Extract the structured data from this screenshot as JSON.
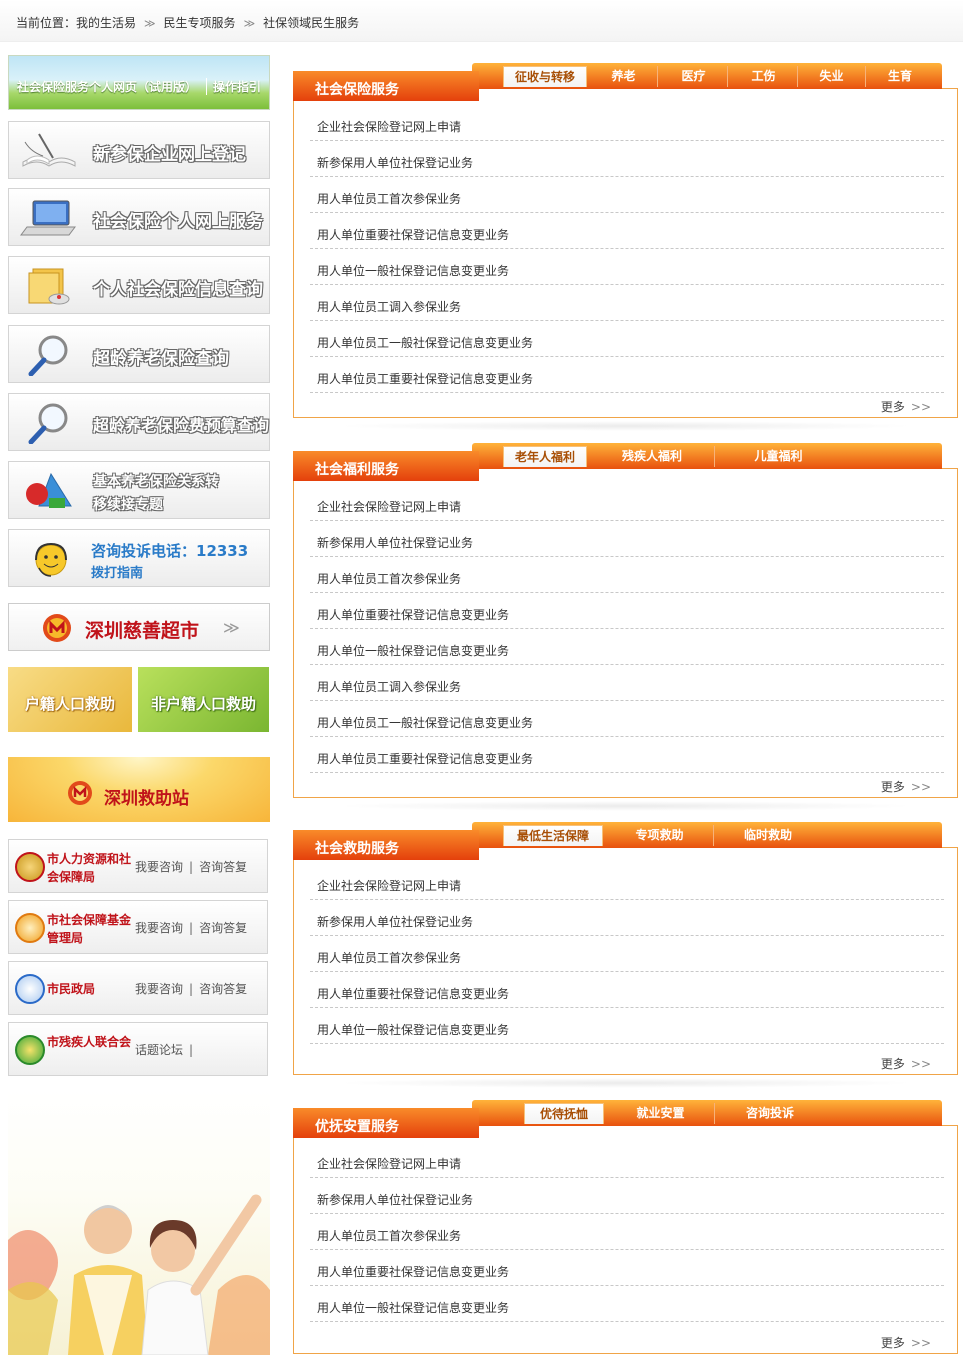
{
  "breadcrumb": {
    "prefix": "当前位置：",
    "items": [
      "我的生活易",
      "民生专项服务",
      "社保领域民生服务"
    ],
    "sep": "≫"
  },
  "left": {
    "banner": {
      "label1": "社会保险服务个人网页（试用版）",
      "label2": "操作指引"
    },
    "buttons": [
      {
        "label": "新参保企业网上登记",
        "icon": "book-pen-icon"
      },
      {
        "label": "社会保险个人网上服务",
        "icon": "laptop-icon"
      },
      {
        "label": "个人社会保险信息查询",
        "icon": "folder-mouse-icon"
      },
      {
        "label": "超龄养老保险查询",
        "icon": "magnifier-icon"
      },
      {
        "label": "超龄养老保险费预算查询",
        "icon": "magnifier-icon"
      },
      {
        "label_line1": "基本养老保险关系转",
        "label_line2": "移续接专题",
        "icon": "shapes-icon"
      },
      {
        "line1": "咨询投诉电话：12333",
        "line2": "拨打指南",
        "icon": "smiley-headset-icon"
      }
    ],
    "charity": {
      "label": "深圳慈善超市",
      "arrow": "≫"
    },
    "help": [
      "户籍人口救助",
      "非户籍人口救助"
    ],
    "station": {
      "label": "深圳救助站"
    },
    "orgs": [
      {
        "name": "市人力资源和社会保障局",
        "links": [
          "我要咨询",
          "咨询答复"
        ]
      },
      {
        "name": "市社会保障基金管理局",
        "links": [
          "我要咨询",
          "咨询答复"
        ]
      },
      {
        "name": "市民政局",
        "links": [
          "我要咨询",
          "咨询答复"
        ]
      },
      {
        "name": "市残疾人联合会",
        "links": [
          "话题论坛",
          ""
        ]
      }
    ],
    "sep_bar": "|"
  },
  "panels": [
    {
      "title": "社会保险服务",
      "tabs": [
        "征收与转移",
        "养老",
        "医疗",
        "工伤",
        "失业",
        "生育"
      ],
      "items": [
        "企业社会保险登记网上申请",
        "新参保用人单位社保登记业务",
        "用人单位员工首次参保业务",
        "用人单位重要社保登记信息变更业务",
        "用人单位一般社保登记信息变更业务",
        "用人单位员工调入参保业务",
        "用人单位员工一般社保登记信息变更业务",
        "用人单位员工重要社保登记信息变更业务"
      ],
      "more": "更多"
    },
    {
      "title": "社会福利服务",
      "tabs": [
        "老年人福利",
        "残疾人福利",
        "儿童福利"
      ],
      "items": [
        "企业社会保险登记网上申请",
        "新参保用人单位社保登记业务",
        "用人单位员工首次参保业务",
        "用人单位重要社保登记信息变更业务",
        "用人单位一般社保登记信息变更业务",
        "用人单位员工调入参保业务",
        "用人单位员工一般社保登记信息变更业务",
        "用人单位员工重要社保登记信息变更业务"
      ],
      "more": "更多"
    },
    {
      "title": "社会救助服务",
      "tabs": [
        "最低生活保障",
        "专项救助",
        "临时救助"
      ],
      "items": [
        "企业社会保险登记网上申请",
        "新参保用人单位社保登记业务",
        "用人单位员工首次参保业务",
        "用人单位重要社保登记信息变更业务",
        "用人单位一般社保登记信息变更业务"
      ],
      "more": "更多"
    },
    {
      "title": "优抚安置服务",
      "tabs": [
        "优待抚恤",
        "就业安置",
        "咨询投诉"
      ],
      "items": [
        "企业社会保险登记网上申请",
        "新参保用人单位社保登记业务",
        "用人单位员工首次参保业务",
        "用人单位重要社保登记信息变更业务",
        "用人单位一般社保登记信息变更业务"
      ],
      "more": "更多"
    }
  ],
  "colors": {
    "accent": "#e8510e",
    "title_red": "#c0131a",
    "link_blue": "#2a7bc8",
    "border": "#f0a448"
  }
}
